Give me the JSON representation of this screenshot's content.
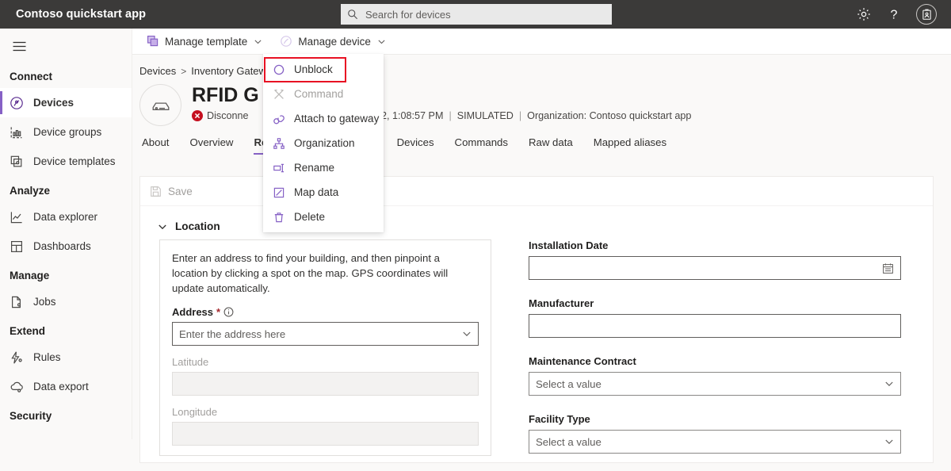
{
  "header": {
    "app_title": "Contoso quickstart app",
    "search": {
      "placeholder": "Search for devices",
      "value": "",
      "icon": "search-icon"
    },
    "actions": [
      {
        "name": "settings-button",
        "icon": "gear-icon"
      },
      {
        "name": "help-button",
        "icon": "question-mark-icon"
      },
      {
        "name": "account-button",
        "icon": "badge-icon"
      }
    ]
  },
  "sidebar": {
    "menu_icon": "hamburger-icon",
    "groups": [
      {
        "label": "Connect",
        "items": [
          {
            "label": "Devices",
            "icon": "devices-icon",
            "active": true
          },
          {
            "label": "Device groups",
            "icon": "device-groups-icon",
            "active": false
          },
          {
            "label": "Device templates",
            "icon": "device-templates-icon",
            "active": false
          }
        ]
      },
      {
        "label": "Analyze",
        "items": [
          {
            "label": "Data explorer",
            "icon": "chart-line-icon",
            "active": false
          },
          {
            "label": "Dashboards",
            "icon": "dashboard-grid-icon",
            "active": false
          }
        ]
      },
      {
        "label": "Manage",
        "items": [
          {
            "label": "Jobs",
            "icon": "jobs-icon",
            "active": false
          }
        ]
      },
      {
        "label": "Extend",
        "items": [
          {
            "label": "Rules",
            "icon": "rules-icon",
            "active": false
          },
          {
            "label": "Data export",
            "icon": "data-export-icon",
            "active": false
          }
        ]
      },
      {
        "label": "Security",
        "items": []
      }
    ]
  },
  "command_bar": {
    "buttons": [
      {
        "label": "Manage template",
        "icon": "manage-template-icon",
        "chevron": true
      },
      {
        "label": "Manage device",
        "icon": "manage-device-icon",
        "chevron": true
      }
    ]
  },
  "device_menu": {
    "items": [
      {
        "label": "Unblock",
        "icon": "unblock-circle-icon",
        "disabled": false,
        "highlighted": true
      },
      {
        "label": "Command",
        "icon": "command-icon",
        "disabled": true,
        "highlighted": false
      },
      {
        "label": "Attach to gateway",
        "icon": "attach-gateway-icon",
        "disabled": false,
        "highlighted": false
      },
      {
        "label": "Organization",
        "icon": "organization-icon",
        "disabled": false,
        "highlighted": false
      },
      {
        "label": "Rename",
        "icon": "rename-icon",
        "disabled": false,
        "highlighted": false
      },
      {
        "label": "Map data",
        "icon": "map-data-icon",
        "disabled": false,
        "highlighted": false
      },
      {
        "label": "Delete",
        "icon": "delete-icon",
        "disabled": false,
        "highlighted": false
      }
    ]
  },
  "breadcrumb": {
    "root": "Devices",
    "separator": ">",
    "current": "Inventory Gatew"
  },
  "device": {
    "avatar_icon": "gateway-device-icon",
    "title": "RFID G",
    "status_icon": "error-circle-icon",
    "status": "Disconne",
    "last_seen": "7/2022, 1:08:57 PM",
    "simulated": "SIMULATED",
    "organization": "Organization: Contoso quickstart app",
    "separator": "|"
  },
  "tabs": [
    {
      "label": "About",
      "active": false
    },
    {
      "label": "Overview",
      "active": false
    },
    {
      "label": "Rea",
      "active": true
    },
    {
      "label": "Devices",
      "active": false
    },
    {
      "label": "Commands",
      "active": false
    },
    {
      "label": "Raw data",
      "active": false
    },
    {
      "label": "Mapped aliases",
      "active": false
    }
  ],
  "card": {
    "save_label": "Save",
    "save_icon": "save-disk-icon",
    "location": {
      "section_title": "Location",
      "description": "Enter an address to find your building, and then pinpoint a location by clicking a spot on the map. GPS coordinates will update automatically.",
      "address_label": "Address",
      "address_required": "*",
      "address_info_icon": "info-icon",
      "address_placeholder": "Enter the address here",
      "latitude_label": "Latitude",
      "latitude_value": "",
      "longitude_label": "Longitude",
      "longitude_value": ""
    },
    "right_fields": [
      {
        "label": "Installation Date",
        "value": "",
        "control": "date",
        "icon": "calendar-icon"
      },
      {
        "label": "Manufacturer",
        "value": "",
        "control": "text",
        "icon": ""
      },
      {
        "label": "Maintenance Contract",
        "value": "Select a value",
        "control": "select",
        "icon": "chevron-down-icon"
      },
      {
        "label": "Facility Type",
        "value": "Select a value",
        "control": "select",
        "icon": "chevron-down-icon"
      }
    ]
  },
  "colors": {
    "accent": "#8661c5",
    "accent_dark": "#5c2e91",
    "header_bg": "#3b3a39",
    "page_bg": "#faf9f8",
    "error": "#c50f1f",
    "highlight": "#e81123"
  }
}
